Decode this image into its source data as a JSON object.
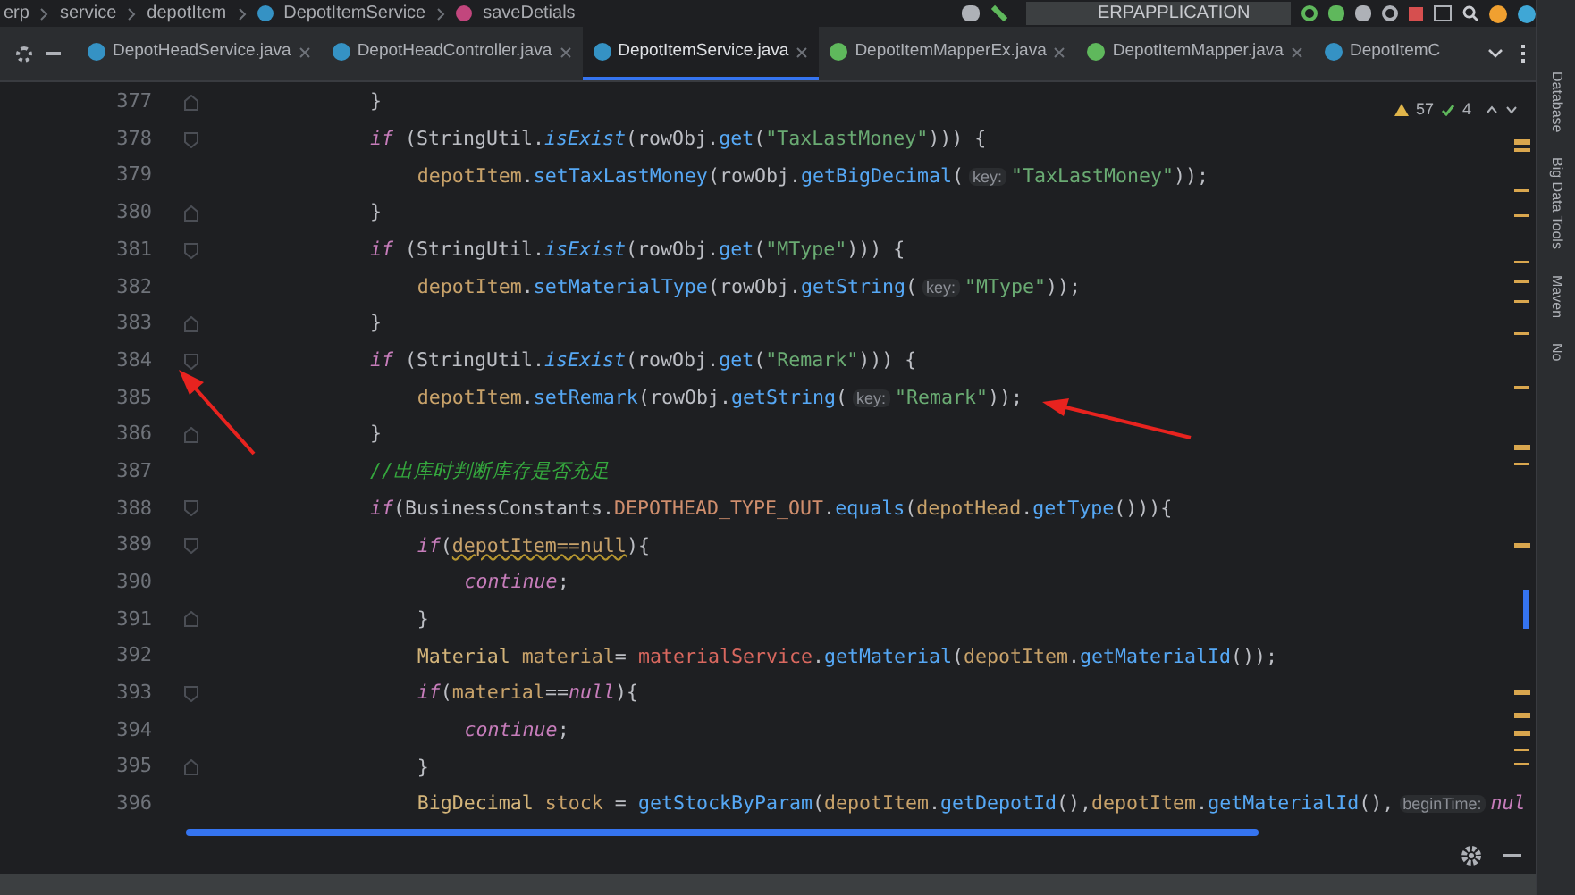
{
  "breadcrumb": [
    {
      "kind": "folder",
      "text": "erp"
    },
    {
      "kind": "folder",
      "text": "service"
    },
    {
      "kind": "folder",
      "text": "depotItem"
    },
    {
      "kind": "class",
      "text": "DepotItemService"
    },
    {
      "kind": "method",
      "text": "saveDetials"
    }
  ],
  "run_config": "ERPAPPLICATION",
  "tabs": [
    {
      "label": "DepotHeadService.java",
      "kind": "class",
      "selected": false
    },
    {
      "label": "DepotHeadController.java",
      "kind": "class",
      "selected": false
    },
    {
      "label": "DepotItemService.java",
      "kind": "class",
      "selected": true
    },
    {
      "label": "DepotItemMapperEx.java",
      "kind": "interface",
      "selected": false
    },
    {
      "label": "DepotItemMapper.java",
      "kind": "interface",
      "selected": false
    },
    {
      "label": "DepotItemC",
      "kind": "class",
      "selected": false
    }
  ],
  "inspections": {
    "warnings": "57",
    "weak_warnings": "4"
  },
  "lines": [
    {
      "number": "377",
      "kind": "closer",
      "tokens": [
        {
          "kind": "plain",
          "text": "}"
        }
      ]
    },
    {
      "number": "378",
      "kind": "opener",
      "tokens": [
        {
          "kind": "keyword",
          "text": "if"
        },
        {
          "kind": "plain",
          "text": " (StringUtil."
        },
        {
          "kind": "static",
          "text": "isExist"
        },
        {
          "kind": "plain",
          "text": "(rowObj."
        },
        {
          "kind": "method",
          "text": "get"
        },
        {
          "kind": "plain",
          "text": "("
        },
        {
          "kind": "string",
          "text": "\"TaxLastMoney\""
        },
        {
          "kind": "plain",
          "text": "))) {"
        }
      ],
      "children": [
        {
          "number": "379",
          "kind": "statement",
          "tokens": [
            {
              "kind": "var",
              "text": "depotItem"
            },
            {
              "kind": "plain",
              "text": "."
            },
            {
              "kind": "method",
              "text": "setTaxLastMoney"
            },
            {
              "kind": "plain",
              "text": "(rowObj."
            },
            {
              "kind": "method",
              "text": "getBigDecimal"
            },
            {
              "kind": "plain",
              "text": "("
            },
            {
              "kind": "hint",
              "text": "key:"
            },
            {
              "kind": "string",
              "text": "\"TaxLastMoney\""
            },
            {
              "kind": "plain",
              "text": "));"
            }
          ]
        }
      ]
    },
    {
      "number": "380",
      "kind": "closer",
      "tokens": [
        {
          "kind": "plain",
          "text": "}"
        }
      ]
    },
    {
      "number": "381",
      "kind": "opener",
      "tokens": [
        {
          "kind": "keyword",
          "text": "if"
        },
        {
          "kind": "plain",
          "text": " (StringUtil."
        },
        {
          "kind": "static",
          "text": "isExist"
        },
        {
          "kind": "plain",
          "text": "(rowObj."
        },
        {
          "kind": "method",
          "text": "get"
        },
        {
          "kind": "plain",
          "text": "("
        },
        {
          "kind": "string",
          "text": "\"MType\""
        },
        {
          "kind": "plain",
          "text": "))) {"
        }
      ],
      "children": [
        {
          "number": "382",
          "kind": "statement",
          "tokens": [
            {
              "kind": "var",
              "text": "depotItem"
            },
            {
              "kind": "plain",
              "text": "."
            },
            {
              "kind": "method",
              "text": "setMaterialType"
            },
            {
              "kind": "plain",
              "text": "(rowObj."
            },
            {
              "kind": "method",
              "text": "getString"
            },
            {
              "kind": "plain",
              "text": "("
            },
            {
              "kind": "hint",
              "text": "key:"
            },
            {
              "kind": "string",
              "text": "\"MType\""
            },
            {
              "kind": "plain",
              "text": "));"
            }
          ]
        }
      ]
    },
    {
      "number": "383",
      "kind": "closer",
      "tokens": [
        {
          "kind": "plain",
          "text": "}"
        }
      ]
    },
    {
      "number": "384",
      "kind": "opener",
      "tokens": [
        {
          "kind": "keyword",
          "text": "if"
        },
        {
          "kind": "plain",
          "text": " (StringUtil."
        },
        {
          "kind": "static",
          "text": "isExist"
        },
        {
          "kind": "plain",
          "text": "(rowObj."
        },
        {
          "kind": "method",
          "text": "get"
        },
        {
          "kind": "plain",
          "text": "("
        },
        {
          "kind": "string",
          "text": "\"Remark\""
        },
        {
          "kind": "plain",
          "text": "))) {"
        }
      ],
      "children": [
        {
          "number": "385",
          "kind": "statement",
          "tokens": [
            {
              "kind": "var",
              "text": "depotItem"
            },
            {
              "kind": "plain",
              "text": "."
            },
            {
              "kind": "method",
              "text": "setRemark"
            },
            {
              "kind": "plain",
              "text": "(rowObj."
            },
            {
              "kind": "method",
              "text": "getString"
            },
            {
              "kind": "plain",
              "text": "("
            },
            {
              "kind": "hint",
              "text": "key:"
            },
            {
              "kind": "string",
              "text": "\"Remark\""
            },
            {
              "kind": "plain",
              "text": "));"
            }
          ]
        }
      ]
    },
    {
      "number": "386",
      "kind": "closer",
      "tokens": [
        {
          "kind": "plain",
          "text": "}"
        }
      ]
    },
    {
      "number": "387",
      "kind": "statement",
      "tokens": [
        {
          "kind": "comment",
          "text": "//出库时判断库存是否充足"
        }
      ]
    },
    {
      "number": "388",
      "kind": "opener",
      "tokens": [
        {
          "kind": "keyword",
          "text": "if"
        },
        {
          "kind": "plain",
          "text": "(BusinessConstants."
        },
        {
          "kind": "constant",
          "text": "DEPOTHEAD_TYPE_OUT"
        },
        {
          "kind": "plain",
          "text": "."
        },
        {
          "kind": "method",
          "text": "equals"
        },
        {
          "kind": "plain",
          "text": "("
        },
        {
          "kind": "var",
          "text": "depotHead"
        },
        {
          "kind": "plain",
          "text": "."
        },
        {
          "kind": "method",
          "text": "getType"
        },
        {
          "kind": "plain",
          "text": "())){"
        }
      ],
      "children": [
        {
          "number": "389",
          "kind": "opener",
          "tokens": [
            {
              "kind": "keyword",
              "text": "if"
            },
            {
              "kind": "plain",
              "text": "("
            },
            {
              "kind": "warning",
              "text": "depotItem==null"
            },
            {
              "kind": "plain",
              "text": "){"
            }
          ],
          "children": [
            {
              "number": "390",
              "kind": "statement",
              "tokens": [
                {
                  "kind": "keyword",
                  "text": "continue"
                },
                {
                  "kind": "plain",
                  "text": ";"
                }
              ]
            }
          ]
        },
        {
          "number": "391",
          "kind": "closer",
          "tokens": [
            {
              "kind": "plain",
              "text": "}"
            }
          ]
        },
        {
          "number": "392",
          "kind": "statement",
          "tokens": [
            {
              "kind": "type",
              "text": "Material"
            },
            {
              "kind": "var",
              "text": " material"
            },
            {
              "kind": "plain",
              "text": "= "
            },
            {
              "kind": "field",
              "text": "materialService"
            },
            {
              "kind": "plain",
              "text": "."
            },
            {
              "kind": "method",
              "text": "getMaterial"
            },
            {
              "kind": "plain",
              "text": "("
            },
            {
              "kind": "var",
              "text": "depotItem"
            },
            {
              "kind": "plain",
              "text": "."
            },
            {
              "kind": "method",
              "text": "getMaterialId"
            },
            {
              "kind": "plain",
              "text": "());"
            }
          ]
        },
        {
          "number": "393",
          "kind": "opener",
          "tokens": [
            {
              "kind": "keyword",
              "text": "if"
            },
            {
              "kind": "plain",
              "text": "("
            },
            {
              "kind": "var",
              "text": "material"
            },
            {
              "kind": "plain",
              "text": "=="
            },
            {
              "kind": "keyword",
              "text": "null"
            },
            {
              "kind": "plain",
              "text": "){"
            }
          ],
          "children": [
            {
              "number": "394",
              "kind": "statement",
              "tokens": [
                {
                  "kind": "keyword",
                  "text": "continue"
                },
                {
                  "kind": "plain",
                  "text": ";"
                }
              ]
            }
          ]
        },
        {
          "number": "395",
          "kind": "closer",
          "tokens": [
            {
              "kind": "plain",
              "text": "}"
            }
          ]
        },
        {
          "number": "396",
          "kind": "statement",
          "tokens": [
            {
              "kind": "type",
              "text": "BigDecimal"
            },
            {
              "kind": "var",
              "text": " stock"
            },
            {
              "kind": "plain",
              "text": " = "
            },
            {
              "kind": "method",
              "text": "getStockByParam"
            },
            {
              "kind": "plain",
              "text": "("
            },
            {
              "kind": "var",
              "text": "depotItem"
            },
            {
              "kind": "plain",
              "text": "."
            },
            {
              "kind": "method",
              "text": "getDepotId"
            },
            {
              "kind": "plain",
              "text": "(),"
            },
            {
              "kind": "var",
              "text": "depotItem"
            },
            {
              "kind": "plain",
              "text": "."
            },
            {
              "kind": "method",
              "text": "getMaterialId"
            },
            {
              "kind": "plain",
              "text": "(),"
            },
            {
              "kind": "hint",
              "text": "beginTime:"
            },
            {
              "kind": "keyword",
              "text": "nul"
            }
          ]
        }
      ]
    }
  ],
  "tool_strip": [
    "Database",
    "Big Data Tools",
    "Maven",
    "No"
  ]
}
